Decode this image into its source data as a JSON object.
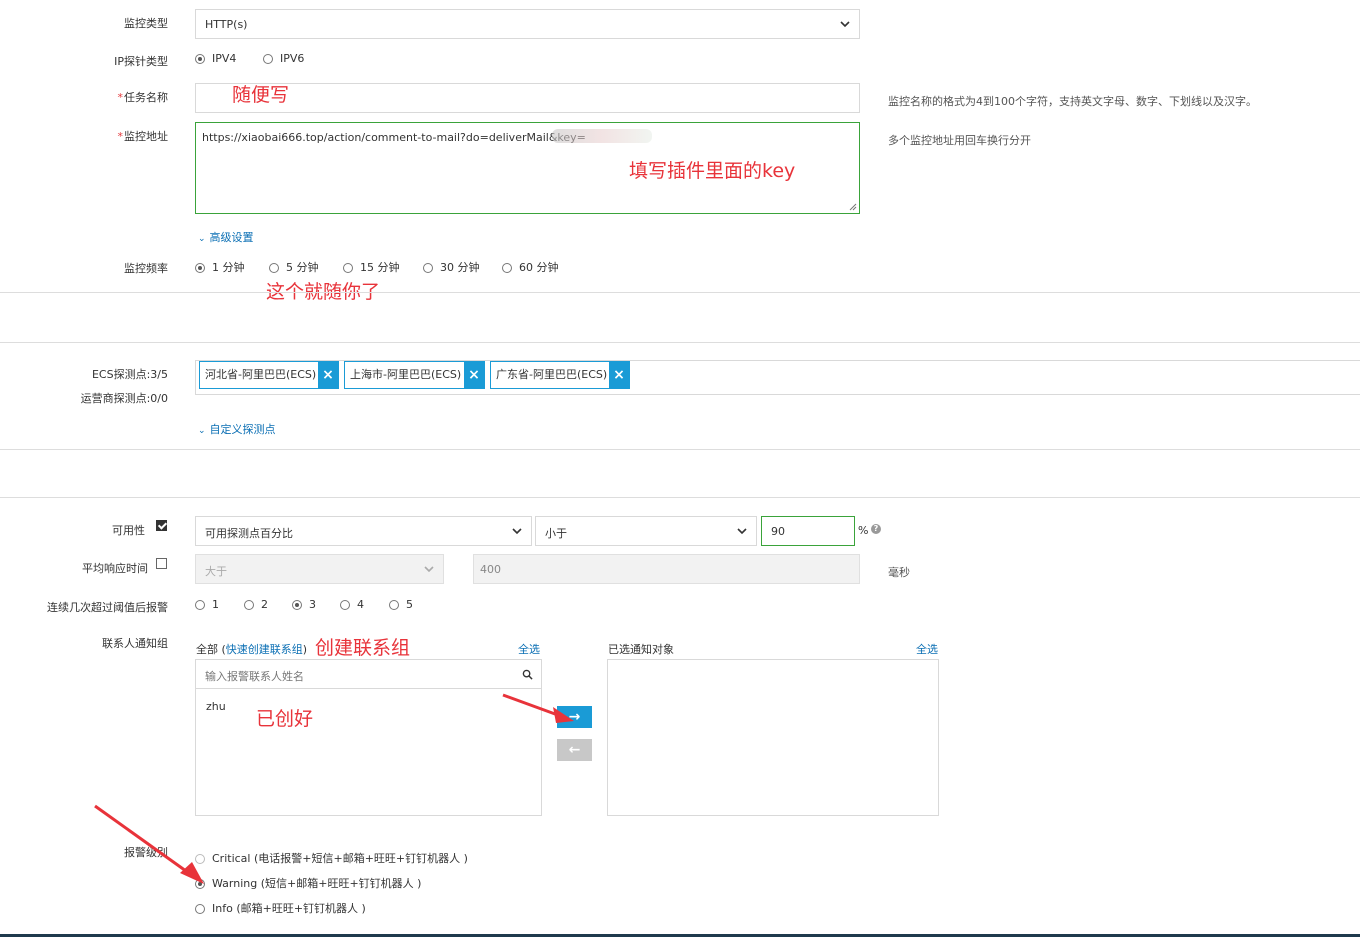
{
  "monitor_type": {
    "label": "监控类型",
    "value": "HTTP(s)"
  },
  "ip_probe": {
    "label": "IP探针类型",
    "options": [
      "IPV4",
      "IPV6"
    ],
    "selected": "IPV4"
  },
  "task_name": {
    "required_mark": "*",
    "label": "任务名称",
    "hint": "监控名称的格式为4到100个字符，支持英文字母、数字、下划线以及汉字。",
    "note": "随便写"
  },
  "monitor_url": {
    "required_mark": "*",
    "label": "监控地址",
    "value": "https://xiaobai666.top/action/comment-to-mail?do=deliverMail&key=",
    "hint": "多个监控地址用回车换行分开",
    "note": "填写插件里面的key"
  },
  "advanced": {
    "label": "高级设置"
  },
  "frequency": {
    "label": "监控频率",
    "options": [
      "1 分钟",
      "5 分钟",
      "15 分钟",
      "30 分钟",
      "60 分钟"
    ],
    "selected": "1 分钟",
    "note": "这个就随你了"
  },
  "probes": {
    "ecs_label": "ECS探测点:3/5",
    "isp_label": "运营商探测点:0/0",
    "tags": [
      "河北省-阿里巴巴(ECS)",
      "上海市-阿里巴巴(ECS)",
      "广东省-阿里巴巴(ECS)"
    ],
    "remove_icon": "×",
    "custom_link": "自定义探测点"
  },
  "availability": {
    "label": "可用性",
    "checked": true,
    "metric": "可用探测点百分比",
    "operator": "小于",
    "value": "90",
    "unit": "%",
    "help_icon": "?"
  },
  "avg_response": {
    "label": "平均响应时间",
    "checked": false,
    "operator": "大于",
    "value": "400",
    "unit": "毫秒"
  },
  "consecutive": {
    "label": "连续几次超过阈值后报警",
    "options": [
      "1",
      "2",
      "3",
      "4",
      "5"
    ],
    "selected": "3"
  },
  "contacts": {
    "label": "联系人通知组",
    "all_prefix": "全部 (",
    "quick_create": "快速创建联系组",
    "all_suffix": ")",
    "select_all_left": "全选",
    "search_placeholder": "输入报警联系人姓名",
    "items": [
      "zhu"
    ],
    "selected_title": "已选通知对象",
    "select_all_right": "全选",
    "note_create": "创建联系组",
    "note_done": "已创好",
    "move_right": "→",
    "move_left": "←"
  },
  "alert_level": {
    "label": "报警级别",
    "options": [
      {
        "name": "Critical",
        "desc": "(电话报警+短信+邮箱+旺旺+钉钉机器人 )"
      },
      {
        "name": "Warning",
        "desc": "(短信+邮箱+旺旺+钉钉机器人 )"
      },
      {
        "name": "Info",
        "desc": "(邮箱+旺旺+钉钉机器人 )"
      }
    ],
    "selected": "Warning"
  },
  "colors": {
    "accent": "#1a9bd6",
    "link": "#0b6fb4",
    "annotation": "#e8333a",
    "focus_green": "#3aa33a"
  }
}
